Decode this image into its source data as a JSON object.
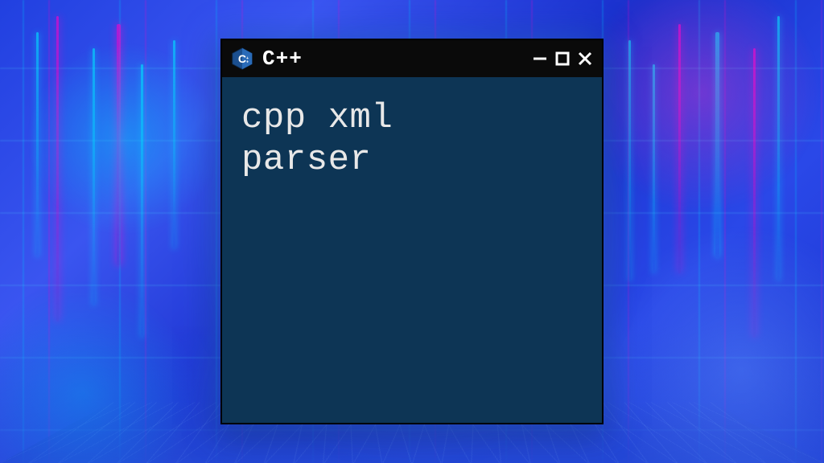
{
  "window": {
    "title": "C++",
    "content_line1": "cpp xml",
    "content_line2": "parser"
  },
  "colors": {
    "titlebar_bg": "#0a0a0a",
    "window_bg": "#0d3555",
    "text": "#e8e8e8"
  }
}
